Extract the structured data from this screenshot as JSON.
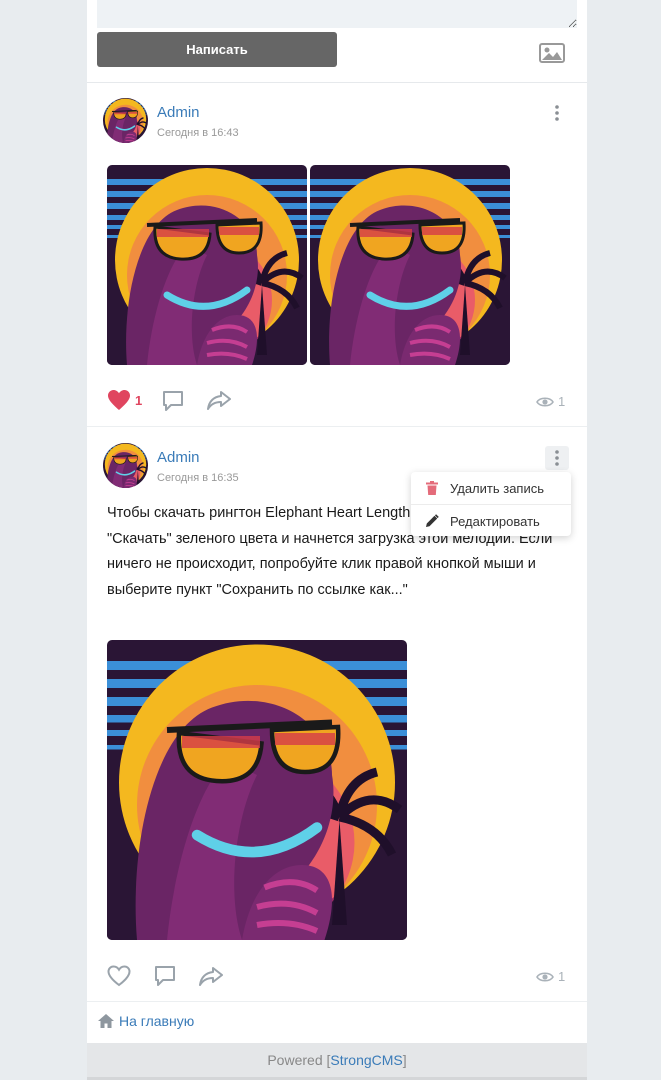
{
  "composer": {
    "submit_label": "Написать",
    "attach_icon": "image-icon"
  },
  "posts": [
    {
      "author": "Admin",
      "time": "Сегодня в 16:43",
      "text": "",
      "likes": "1",
      "liked": true,
      "views": "1"
    },
    {
      "author": "Admin",
      "time": "Сегодня в 16:35",
      "text": "Чтобы скачать рингтон Elephant Heart Length, нажмите на значок \"Скачать\" зеленого цвета и начнется загрузка этой мелодии. Если ничего не происходит, попробуйте клик правой кнопкой мыши и выберите пункт \"Сохранить по ссылке как...\"",
      "likes": "",
      "liked": false,
      "views": "1"
    }
  ],
  "dropdown": {
    "delete_label": "Удалить запись",
    "edit_label": "Редактировать"
  },
  "nav": {
    "home_label": "На главную"
  },
  "footer": {
    "prefix": "Powered [",
    "brand": "StrongCMS",
    "suffix": "]"
  },
  "colors": {
    "accent": "#3a7bb8",
    "like": "#e0455f",
    "delete": "#e46b7a"
  }
}
